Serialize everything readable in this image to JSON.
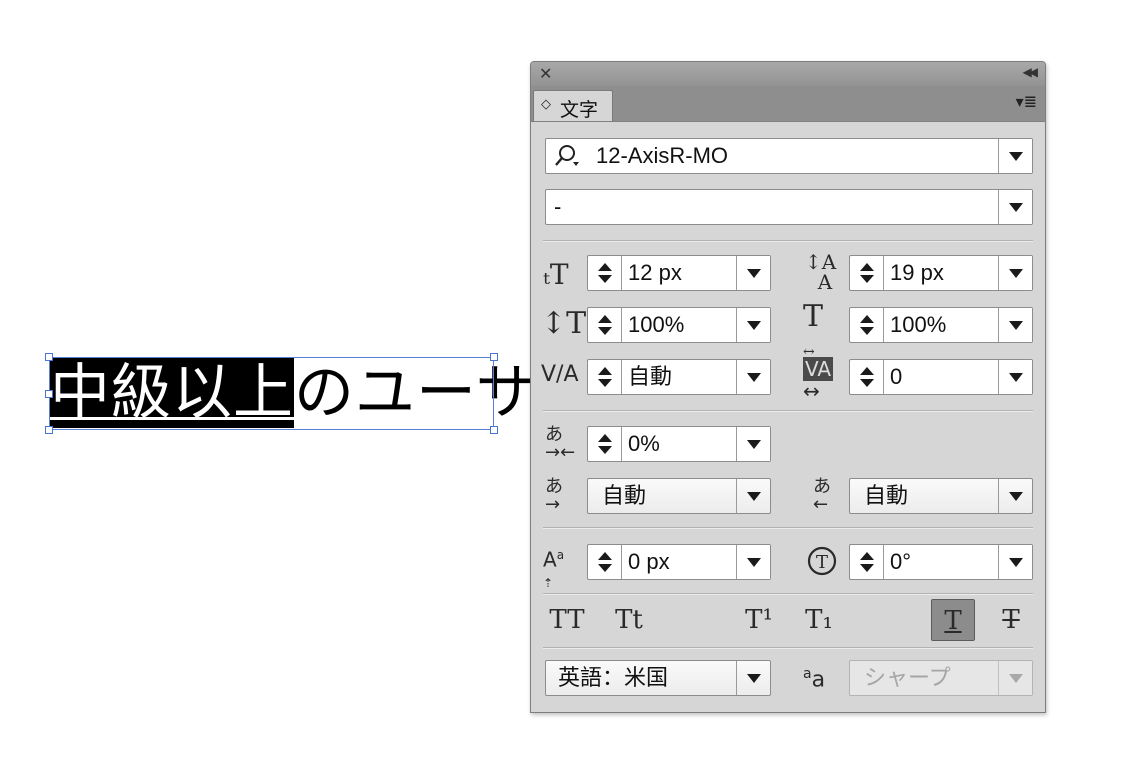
{
  "canvas": {
    "selected_text": "中級以上",
    "rest_text": "のユーサ"
  },
  "panel": {
    "title": "文字",
    "font_family": "12-AxisR-MO",
    "font_style": "-",
    "font_size": "12 px",
    "leading": "19 px",
    "vertical_scale": "100%",
    "horizontal_scale": "100%",
    "kerning": "自動",
    "tracking": "0",
    "tsume": "0%",
    "aki_left": "自動",
    "aki_right": "自動",
    "baseline_shift": "0 px",
    "rotation": "0°",
    "language": "英語：米国",
    "antialias": "シャープ",
    "style_buttons": [
      "TT",
      "Tt",
      "T¹",
      "T₁",
      "T",
      "T"
    ]
  },
  "colors": {
    "panel_bg": "#d6d6d6",
    "selection_border": "#5b7fd6",
    "active_button": "#8c8c8c"
  },
  "icons": {
    "close": "close-icon",
    "collapse": "double-chevron-left-icon",
    "panel_menu": "panel-menu-icon",
    "search": "search-icon"
  }
}
